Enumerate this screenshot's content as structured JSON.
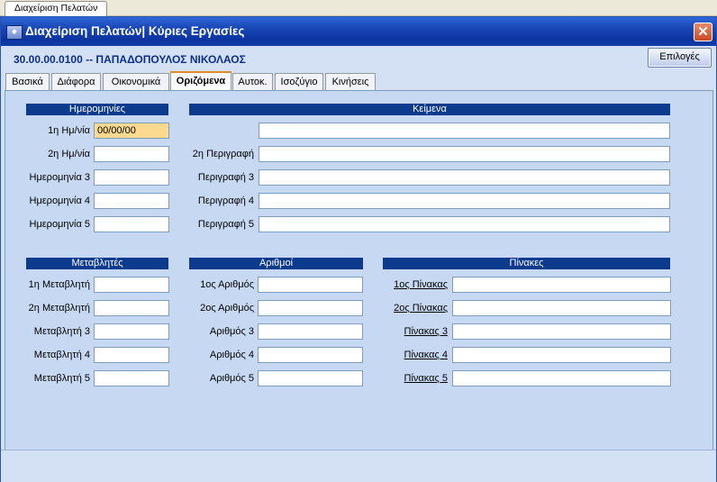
{
  "doc_tab": "Διαχείριση Πελατών",
  "window": {
    "title": "Διαχείριση Πελατών| Κύριες Εργασίες",
    "icon": "app-icon",
    "close_label": "✕"
  },
  "customer_line": "30.00.00.0100 -- ΠΑΠΑΔΟΠΟΥΛΟΣ ΝΙΚΟΛΑΟΣ",
  "options_label": "Επιλογές",
  "tabs": [
    "Βασικά",
    "Διάφορα",
    "Οικονομικά",
    "Οριζόμενα",
    "Αυτοκ.",
    "Ισοζύγιο",
    "Κινήσεις"
  ],
  "active_tab": "Οριζόμενα",
  "dates": {
    "header": "Ημερομηνίες",
    "labels": [
      "1η Ημ/νία",
      "2η Ημ/νία",
      "Ημερομηνία 3",
      "Ημερομηνία 4",
      "Ημερομηνία 5"
    ],
    "values": [
      "00/00/00",
      "",
      "",
      "",
      ""
    ]
  },
  "texts": {
    "header": "Κείμενα",
    "labels": [
      "2η Περιγραφή",
      "Περιγραφή 3",
      "Περιγραφή 4",
      "Περιγραφή 5"
    ],
    "values": [
      "",
      "",
      "",
      "",
      ""
    ]
  },
  "variables": {
    "header": "Μεταβλητές",
    "labels": [
      "1η Μεταβλητή",
      "2η Μεταβλητή",
      "Μεταβλητή 3",
      "Μεταβλητή 4",
      "Μεταβλητή 5"
    ],
    "values": [
      "",
      "",
      "",
      "",
      ""
    ]
  },
  "numbers": {
    "header": "Αριθμοί",
    "labels": [
      "1ος Αριθμός",
      "2ος Αριθμός",
      "Αριθμός 3",
      "Αριθμός 4",
      "Αριθμός 5"
    ],
    "values": [
      "",
      "",
      "",
      "",
      ""
    ]
  },
  "tables": {
    "header": "Πίνακες",
    "labels": [
      "1ος Πίνακας",
      "2ος Πίνακας",
      "Πίνακας 3",
      "Πίνακας 4",
      "Πίνακας 5"
    ],
    "values": [
      "",
      "",
      "",
      "",
      ""
    ]
  }
}
